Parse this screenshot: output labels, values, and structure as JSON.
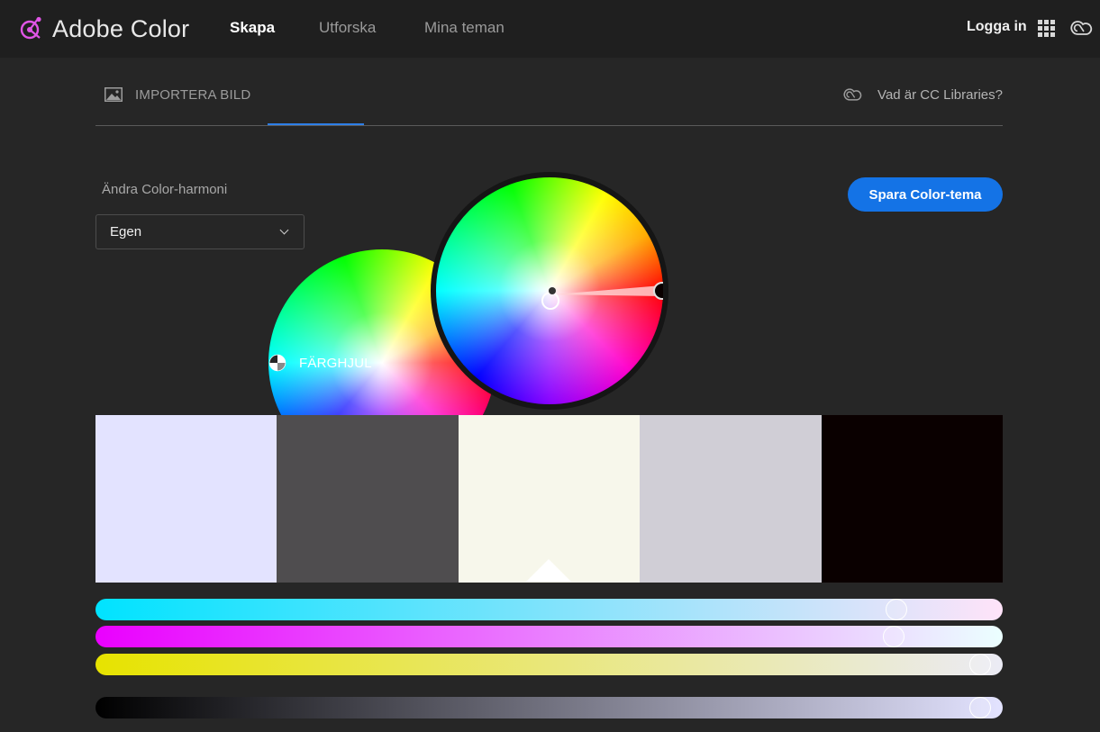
{
  "app": {
    "name": "Adobe Color"
  },
  "nav": {
    "links": [
      {
        "label": "Skapa",
        "active": true
      },
      {
        "label": "Utforska",
        "active": false
      },
      {
        "label": "Mina teman",
        "active": false
      }
    ],
    "login": "Logga in"
  },
  "tabs": {
    "import": "IMPORTERA BILD",
    "wheel": "FÄRGHJUL",
    "active": "wheel",
    "cc_libraries": "Vad är CC Libraries?"
  },
  "harmony": {
    "label": "Ändra Color-harmoni",
    "selected": "Egen"
  },
  "save_button": "Spara Color-tema",
  "palette": {
    "swatches": [
      "#E3E3FF",
      "#4F4D4F",
      "#F7F7EB",
      "#D0CED6",
      "#0A0000"
    ],
    "selected_index": 2
  },
  "sliders": [
    {
      "name": "cyan",
      "from": "#00E3FF",
      "to": "#FFE3F9",
      "value": 0.892
    },
    {
      "name": "magenta",
      "from": "#EA00FF",
      "to": "#EBFFFF",
      "value": 0.889
    },
    {
      "name": "yellow",
      "from": "#E7E300",
      "to": "#EBEBF5",
      "value": 0.987
    },
    {
      "name": "black",
      "from": "#000000",
      "to": "#E3E3FF",
      "value": 0.987
    }
  ],
  "colors": {
    "accent": "#1473E6",
    "tab_underline": "#2D7FE8",
    "background": "#262626",
    "topbar": "#1F1F1F"
  },
  "icons": [
    "adobe-color-logo-icon",
    "apps-grid-icon",
    "creative-cloud-icon",
    "image-icon",
    "color-wheel-icon",
    "chevron-down-icon"
  ]
}
